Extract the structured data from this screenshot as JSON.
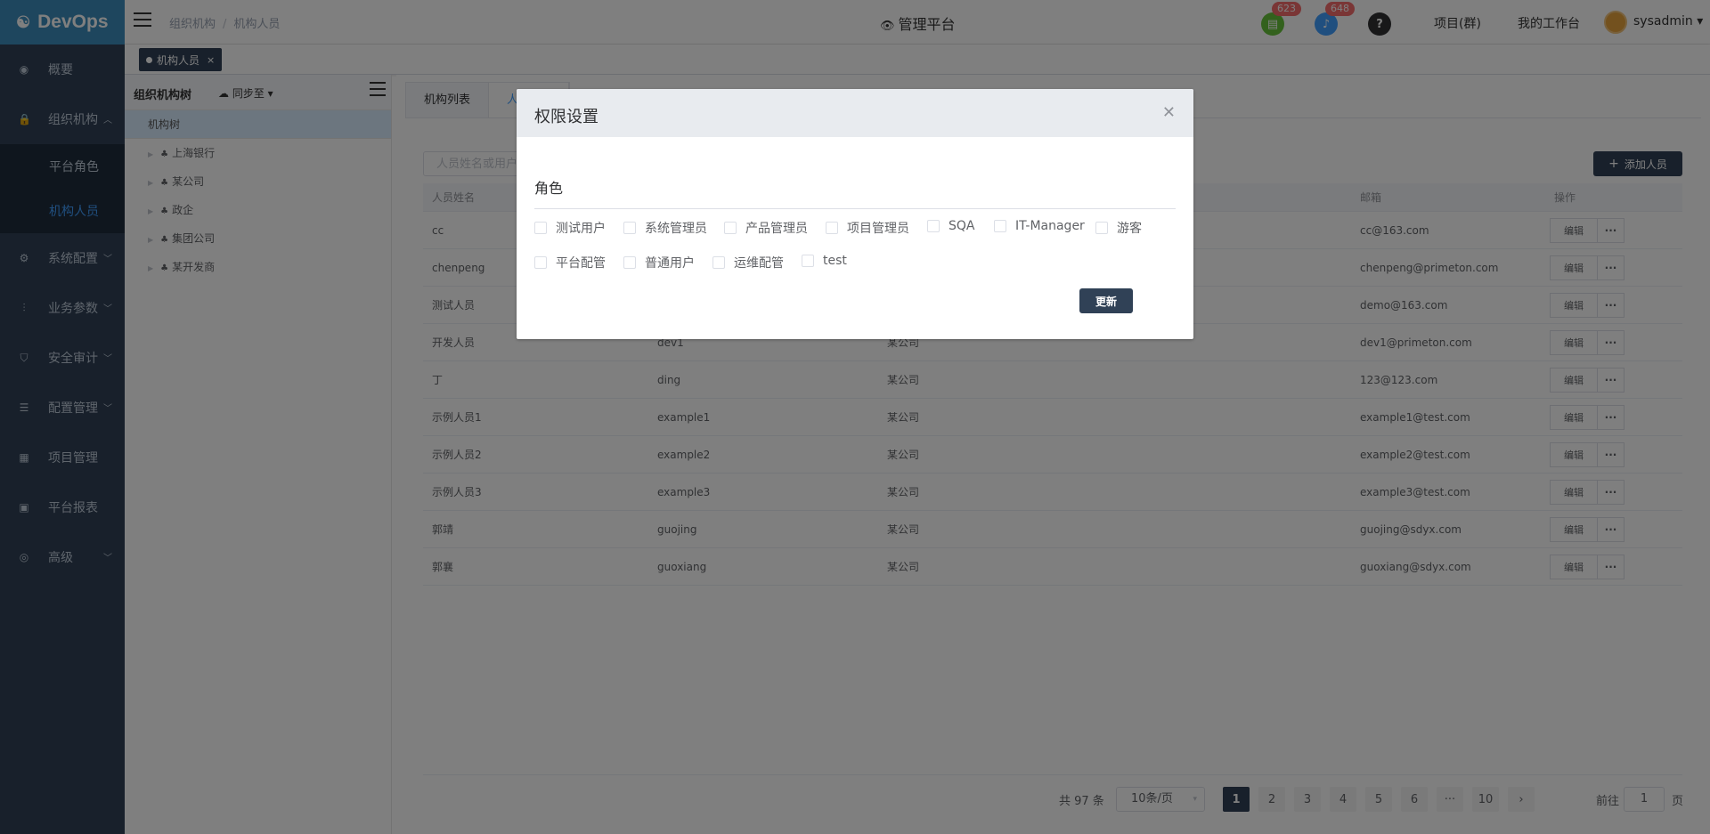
{
  "app": {
    "logo_text": "DevOps",
    "breadcrumb": [
      "组织机构",
      "机构人员"
    ],
    "platform_title": "管理平台",
    "notifications": [
      {
        "icon": "document-icon",
        "count": "623",
        "color": "#67c23a"
      },
      {
        "icon": "bell-icon",
        "count": "648",
        "color": "#409eff"
      },
      {
        "icon": "help-icon",
        "count": "",
        "color": "#303133"
      }
    ],
    "links": [
      "项目(群)",
      "我的工作台"
    ],
    "username": "sysadmin"
  },
  "sidebar": {
    "items": [
      {
        "label": "概要",
        "icon": "dashboard-icon"
      },
      {
        "label": "组织机构",
        "icon": "lock-icon",
        "expanded": true,
        "children": [
          {
            "label": "平台角色",
            "active": false
          },
          {
            "label": "机构人员",
            "active": true
          }
        ]
      },
      {
        "label": "系统配置",
        "icon": "gear-icon"
      },
      {
        "label": "业务参数",
        "icon": "sliders-icon"
      },
      {
        "label": "安全审计",
        "icon": "shield-icon"
      },
      {
        "label": "配置管理",
        "icon": "database-icon"
      },
      {
        "label": "项目管理",
        "icon": "grid-icon"
      },
      {
        "label": "平台报表",
        "icon": "monitor-icon"
      },
      {
        "label": "高级",
        "icon": "gauge-icon"
      }
    ]
  },
  "tags": [
    {
      "label": "机构人员",
      "closable": "×"
    }
  ],
  "tree": {
    "title": "组织机构树",
    "sync_label": "同步至",
    "root": "机构树",
    "nodes": [
      "上海银行",
      "某公司",
      "政企",
      "集团公司",
      "某开发商"
    ]
  },
  "main": {
    "tabs": [
      "机构列表",
      "人"
    ],
    "search_placeholder": "人员姓名或用户",
    "add_button": "添加人员",
    "columns": [
      "人员姓名",
      "",
      "",
      "邮箱",
      "操作"
    ],
    "rows": [
      {
        "name": "cc",
        "user": "",
        "org": "",
        "email": "cc@163.com"
      },
      {
        "name": "chenpeng",
        "user": "",
        "org": "",
        "email": "chenpeng@primeton.com"
      },
      {
        "name": "测试人员",
        "user": "",
        "org": "",
        "email": "demo@163.com"
      },
      {
        "name": "开发人员",
        "user": "dev1",
        "org": "某公司",
        "email": "dev1@primeton.com"
      },
      {
        "name": "丁",
        "user": "ding",
        "org": "某公司",
        "email": "123@123.com"
      },
      {
        "name": "示例人员1",
        "user": "example1",
        "org": "某公司",
        "email": "example1@test.com"
      },
      {
        "name": "示例人员2",
        "user": "example2",
        "org": "某公司",
        "email": "example2@test.com"
      },
      {
        "name": "示例人员3",
        "user": "example3",
        "org": "某公司",
        "email": "example3@test.com"
      },
      {
        "name": "郭靖",
        "user": "guojing",
        "org": "某公司",
        "email": "guojing@sdyx.com"
      },
      {
        "name": "郭襄",
        "user": "guoxiang",
        "org": "某公司",
        "email": "guoxiang@sdyx.com"
      }
    ],
    "edit_label": "编辑",
    "more_label": "···"
  },
  "pagination": {
    "total": "共 97 条",
    "page_size": "10条/页",
    "pages": [
      "1",
      "2",
      "3",
      "4",
      "5",
      "6",
      "···",
      "10"
    ],
    "current": "1",
    "goto_label": "前往",
    "goto_value": "1",
    "page_suffix": "页"
  },
  "dialog": {
    "title": "权限设置",
    "section": "角色",
    "roles_row1": [
      "测试用户",
      "系统管理员",
      "产品管理员",
      "项目管理员",
      "SQA",
      "IT-Manager",
      "游客"
    ],
    "roles_row2": [
      "平台配管",
      "普通用户",
      "运维配管",
      "test"
    ],
    "submit": "更新"
  }
}
